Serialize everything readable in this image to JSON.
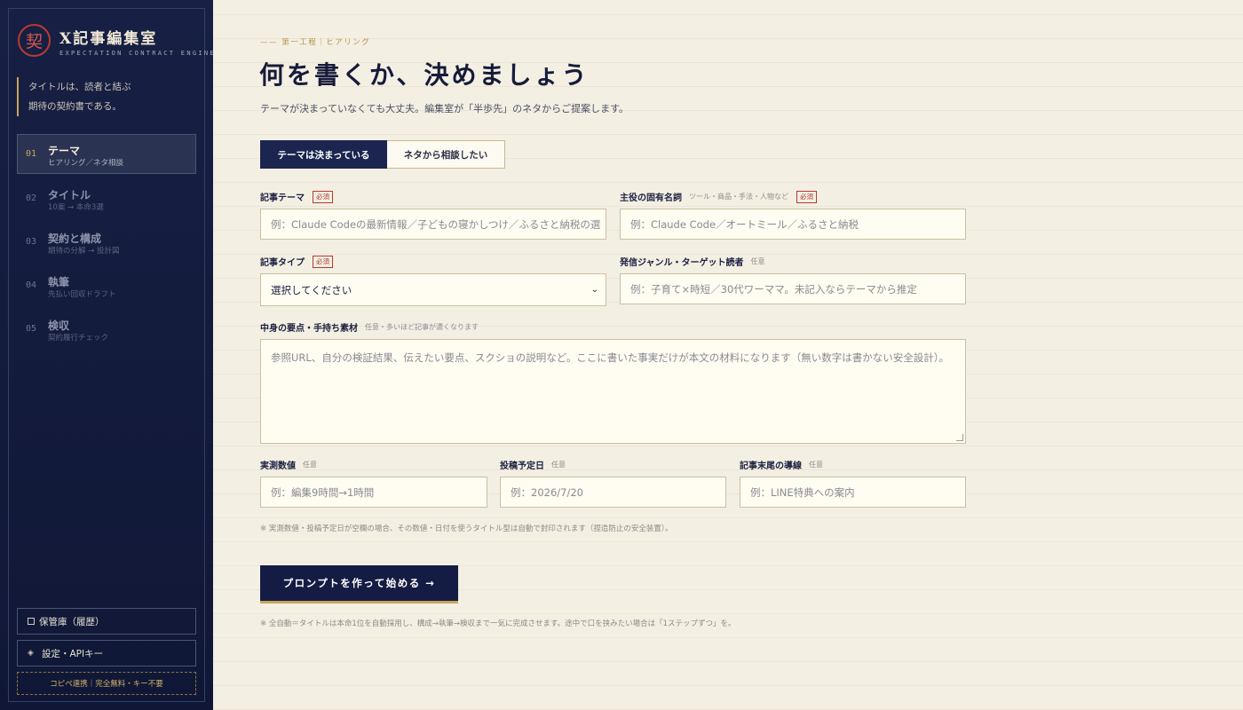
{
  "sidebar": {
    "seal": "契",
    "title": "X記事編集室",
    "subtitle": "EXPECTATION CONTRACT ENGINE",
    "tagline": [
      "タイトルは、読者と結ぶ",
      "期待の契約書である。"
    ],
    "steps": [
      {
        "num": "01",
        "title": "テーマ",
        "desc": "ヒアリング／ネタ相談",
        "active": true
      },
      {
        "num": "02",
        "title": "タイトル",
        "desc": "10案 → 本命3選",
        "active": false
      },
      {
        "num": "03",
        "title": "契約と構成",
        "desc": "期待の分解 → 設計図",
        "active": false
      },
      {
        "num": "04",
        "title": "執筆",
        "desc": "先払い回収ドラフト",
        "active": false
      },
      {
        "num": "05",
        "title": "検収",
        "desc": "契約履行チェック",
        "active": false
      }
    ],
    "vault_label": "保管庫（履歴）",
    "settings_icon": "◈",
    "settings_label": "設定・APIキー",
    "note": "コピペ連携｜完全無料・キー不要"
  },
  "main": {
    "eyebrow": "—— 第一工程｜ヒアリング",
    "title": "何を書くか、決めましょう",
    "subtitle": "テーマが決まっていなくても大丈夫。編集室が「半歩先」のネタからご提案します。",
    "tabs": [
      {
        "label": "テーマは決まっている",
        "active": true
      },
      {
        "label": "ネタから相談したい",
        "active": false
      }
    ],
    "required_badge": "必須",
    "fields": {
      "theme": {
        "label": "記事テーマ",
        "placeholder": "例：Claude Codeの最新情報／子どもの寝かしつけ／ふるさと納税の選"
      },
      "noun": {
        "label": "主役の固有名詞",
        "hint": "ツール・商品・手法・人物など",
        "placeholder": "例：Claude Code／オートミール／ふるさと納税"
      },
      "type": {
        "label": "記事タイプ",
        "value": "選択してください"
      },
      "genre": {
        "label": "発信ジャンル・ターゲット読者",
        "hint": "任意",
        "placeholder": "例：子育て×時短／30代ワーママ。未記入ならテーマから推定"
      },
      "material": {
        "label": "中身の要点・手持ち素材",
        "hint": "任意・多いほど記事が濃くなります",
        "placeholder": "参照URL、自分の検証結果、伝えたい要点、スクショの説明など。ここに書いた事実だけが本文の材料になります（無い数字は書かない安全設計）。"
      },
      "measured": {
        "label": "実測数値",
        "hint": "任意",
        "placeholder": "例：編集9時間→1時間"
      },
      "date": {
        "label": "投稿予定日",
        "hint": "任意",
        "placeholder": "例：2026/7/20"
      },
      "ending": {
        "label": "記事末尾の導線",
        "hint": "任意",
        "placeholder": "例：LINE特典への案内"
      }
    },
    "note": "※ 実測数値・投稿予定日が空欄の場合、その数値・日付を使うタイトル型は自動で封印されます（捏造防止の安全装置）。",
    "cta": "プロンプトを作って始める →",
    "foot_note": "※ 全自動＝タイトルは本命1位を自動採用し、構成→執筆→検収まで一気に完成させます。途中で口を挟みたい場合は「1ステップずつ」を。"
  },
  "colors": {
    "sidebar_bg": "#172044",
    "accent_gold": "#c8a55a",
    "seal_red": "#b83a32",
    "page_bg": "#f4efe3"
  }
}
